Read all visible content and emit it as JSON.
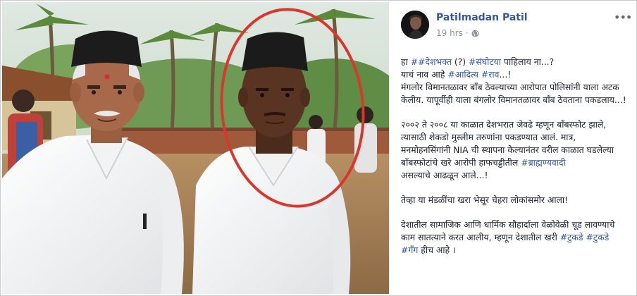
{
  "post": {
    "author": "Patilmadan Patil",
    "time": "19 hrs",
    "dot": "·",
    "more_icon": "more-options-icon",
    "privacy_icon": "globe-icon",
    "p1": {
      "l1_a": "हा ",
      "l1_t1": "##देशभक्त",
      "l1_b": " (?) ",
      "l1_t2": "#संघोटया",
      "l1_c": " पाहिलाय ना...?",
      "l2_a": "याचं नाव आहे ",
      "l2_t1": "#आदित्य",
      "l2_b": " ",
      "l2_t2": "#राव",
      "l2_c": "...!",
      "l3": "मंगलोर विमानतळावर बाँब ठेवल्याच्या आरोपात पोलिसांनी याला अटक केलीय. यापूर्वीही याला बंगलोर विमानतळावर बाँब ठेवताना पकडलाय...!"
    },
    "p2": {
      "text": "२००२ ते २००८ या काळात देशभरात जेवढे म्हणून बाँबस्फोट झाले, त्यासाठी शेकडो मुस्लीम तरुणांना पकडण्यात आलं. मात्र, मनमोहनसिंगांनी NIA ची स्थापना केल्यानंतर वरील काळात घडलेल्या बाँबस्फोटांचे खरे आरोपी हाफचड्डीतील ",
      "tag": "#ब्राह्मण्यवादी",
      "end": "असल्याचे आढळून आले...!"
    },
    "p3": "तेव्हा या मंडळींचा खरा भेसूर चेहरा लोकांसमोर आला!",
    "p4": {
      "text": "देशातील सामाजिक आणि धार्मिक सौहार्दाला वेळोवेळी चूड लावण्याचे काम सातत्याने करत आलीय, म्हणून देशातील खरी ",
      "t1": "#टुकडे",
      "s1": " ",
      "t2": "#टुकडे",
      "s2": " ",
      "t3": "#गँग",
      "end": " हीच आहे ।"
    }
  },
  "colors": {
    "link": "#365899",
    "text": "#1d2129",
    "meta": "#90949c",
    "circle": "#d9372e"
  }
}
